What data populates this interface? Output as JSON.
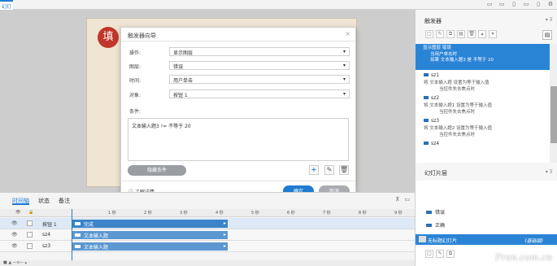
{
  "app": {
    "tab_label": "幻灯片"
  },
  "slide": {
    "stamp_char": "填"
  },
  "dialog": {
    "title": "触发器向导",
    "fields": [
      {
        "label": "操作:",
        "value": "显示图层"
      },
      {
        "label": "图层:",
        "value": "错误"
      },
      {
        "label": "时间:",
        "value": "用户单击"
      },
      {
        "label": "对象:",
        "value": "按钮 1"
      }
    ],
    "condition_label": "条件:",
    "condition_text": "文本输入题3 != 不等于 20",
    "hide_conditions": "隐藏条件",
    "learn_more": "了解详情...",
    "ok": "确定",
    "cancel": "取消"
  },
  "timeline": {
    "tabs": [
      "时间轴",
      "状态",
      "备注"
    ],
    "ruler": [
      "1 秒",
      "2 秒",
      "3 秒",
      "4 秒",
      "5 秒",
      "6 秒",
      "7 秒",
      "8 秒",
      "9 秒"
    ],
    "rows": [
      {
        "name": "按钮 1",
        "bar": "完成",
        "selected": true
      },
      {
        "name": "sz4",
        "bar": "文本输入题",
        "selected": false
      },
      {
        "name": "sz3",
        "bar": "文本输入题",
        "selected": false
      }
    ]
  },
  "triggers": {
    "title": "触发器",
    "selected": {
      "line1": "显示图层 错误",
      "line2": "当用户单击时",
      "line3": "如果 文本输入题3 是 不等于 20"
    },
    "items": [
      {
        "name": "sz1",
        "line1": "将 文本输入题 设置为等于输入值",
        "line2": "当控件失去焦点时"
      },
      {
        "name": "sz2",
        "line1": "将 文本输入题1 设置为等于输入值",
        "line2": "当控件失去焦点时"
      },
      {
        "name": "sz3",
        "line1": "将 文本输入题2 设置为等于输入值",
        "line2": "当控件失去焦点时"
      },
      {
        "name": "sz4",
        "line1": "",
        "line2": ""
      }
    ]
  },
  "slide_layers": {
    "title": "幻灯片层",
    "layers": [
      "错误",
      "正确"
    ],
    "base": {
      "name": "无标题幻灯片",
      "tag": "(基础层)"
    }
  },
  "watermark": "Fran.com.cn",
  "colors": {
    "accent": "#1e7cd1",
    "selected_bg": "#2a84d6",
    "stamp": "#c2362b"
  }
}
